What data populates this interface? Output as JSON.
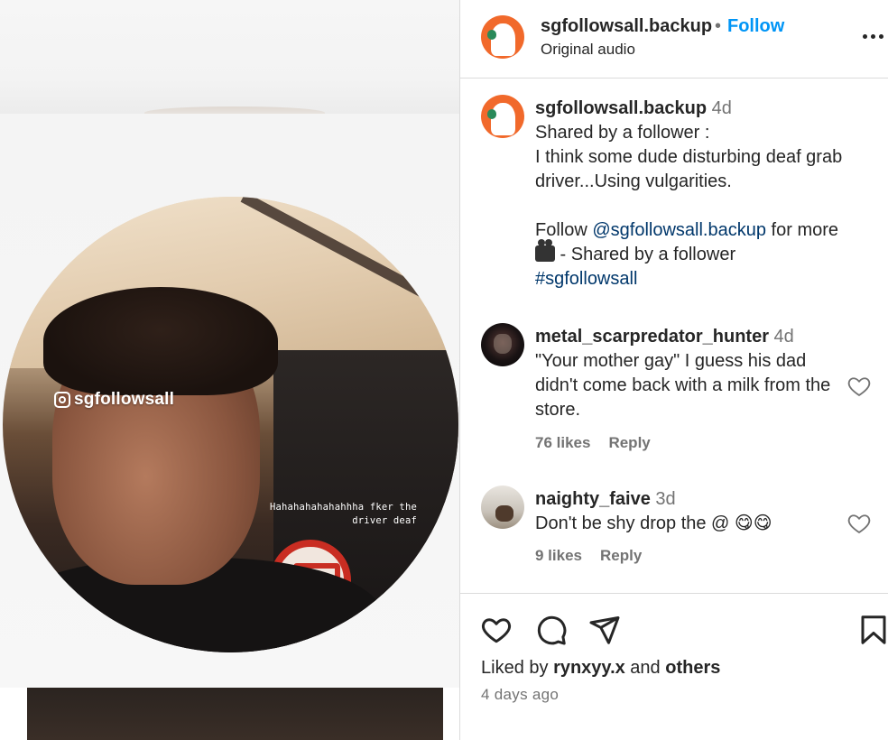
{
  "media": {
    "watermark": "sgfollowsall",
    "overlay_caption_line1": "Hahahahahahahhha fker the",
    "overlay_caption_line2": "driver deaf"
  },
  "header": {
    "username": "sgfollowsall.backup",
    "separator": "•",
    "follow_label": "Follow",
    "subtitle": "Original audio",
    "more_icon": "more-horizontal-icon"
  },
  "caption": {
    "username": "sgfollowsall.backup",
    "age": "4d",
    "line1": "Shared by a follower :",
    "line2": "I think some dude disturbing deaf grab driver...Using vulgarities.",
    "follow_prefix": "Follow ",
    "mention": "@sgfollowsall.backup",
    "follow_suffix": " for more",
    "camera_icon": "movie-camera-icon",
    "shared_line": " - Shared by a follower",
    "hashtag": "#sgfollowsall"
  },
  "comments": [
    {
      "username": "metal_scarpredator_hunter",
      "age": "4d",
      "text": "\"Your mother gay\" I guess his dad didn't come back with a milk from the store.",
      "likes": "76 likes",
      "reply_label": "Reply"
    },
    {
      "username": "naighty_faive",
      "age": "3d",
      "text": "Don't be shy drop the @ ",
      "emoji": "😋😋",
      "likes": "9 likes",
      "reply_label": "Reply"
    }
  ],
  "actions": {
    "like_icon": "heart-icon",
    "comment_icon": "comment-icon",
    "share_icon": "send-icon",
    "save_icon": "bookmark-icon"
  },
  "liked_by": {
    "prefix": "Liked by ",
    "user": "rynxyy.x",
    "middle": " and ",
    "others": "others"
  },
  "time_ago": "4 days ago"
}
